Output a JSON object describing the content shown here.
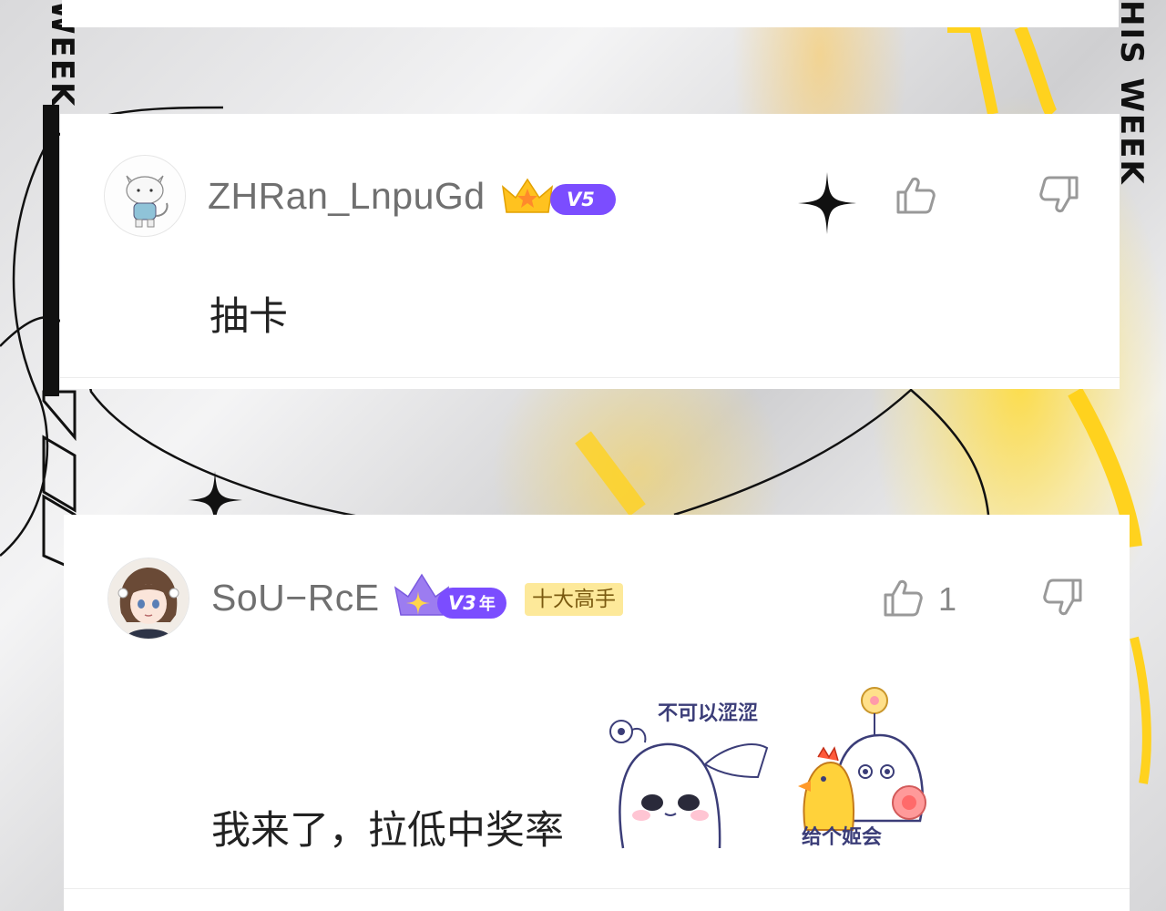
{
  "background": {
    "left_vertical_text": "WEEK",
    "right_vertical_text": "HIS  WEEK",
    "accent_color": "#ffd21e"
  },
  "comments": [
    {
      "username": "ZHRan_LnpuGd",
      "avatar_icon": "white-cat-avatar",
      "crown_icon": "gold-crown-icon",
      "vip_label": "V5",
      "vip_color": "#7b4dff",
      "text": "抽卡",
      "like_count": "",
      "like_icon": "thumbs-up-icon",
      "dislike_icon": "thumbs-down-icon"
    },
    {
      "username": "SoU−RcE",
      "avatar_icon": "anime-girl-avatar",
      "crown_icon": "purple-crown-icon",
      "vip_label": "V3",
      "vip_suffix": "年",
      "vip_color": "#7b4dff",
      "rank_badge": "十大高手",
      "rank_badge_color": "#fde99a",
      "text": "我来了，拉低中奖率",
      "like_count": "1",
      "like_icon": "thumbs-up-icon",
      "dislike_icon": "thumbs-down-icon",
      "stickers": [
        {
          "icon": "poke-blob-sticker",
          "caption": "不可以涩涩"
        },
        {
          "icon": "chicken-blob-sticker",
          "caption": "给个姬会"
        }
      ]
    }
  ]
}
